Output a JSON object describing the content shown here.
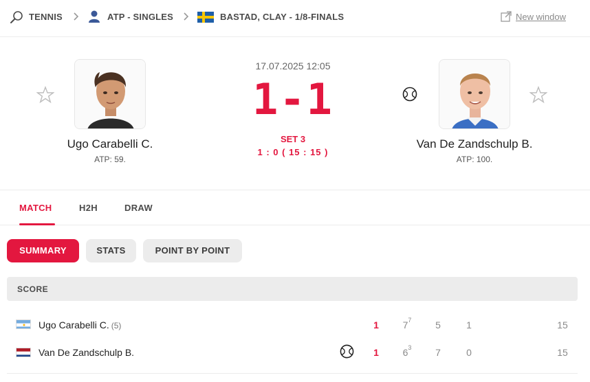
{
  "breadcrumb": {
    "sport": "TENNIS",
    "category": "ATP - SINGLES",
    "tournament": "BASTAD, CLAY - 1/8-FINALS",
    "new_window": "New window",
    "icons": [
      "racket-icon",
      "person-icon",
      "sweden-flag-icon",
      "external-link-icon"
    ]
  },
  "match": {
    "datetime": "17.07.2025 12:05",
    "score": "1-1",
    "set_label": "SET 3",
    "set_detail": "1 : 0 ( 15 : 15 )",
    "home": {
      "name": "Ugo Carabelli C.",
      "rank": "ATP: 59."
    },
    "away": {
      "name": "Van De Zandschulp B.",
      "rank": "ATP: 100.",
      "serving": true
    }
  },
  "tabs": [
    "MATCH",
    "H2H",
    "DRAW"
  ],
  "active_tab": "MATCH",
  "subtabs": [
    "SUMMARY",
    "STATS",
    "POINT BY POINT"
  ],
  "active_subtab": "SUMMARY",
  "score_table": {
    "header": "SCORE",
    "rows": [
      {
        "name": "Ugo Carabelli C.",
        "seed": "(5)",
        "flag": "argentina",
        "sets_won": "1",
        "s1": "7",
        "s1_tb": "7",
        "s2": "5",
        "s3": "1",
        "points": "15"
      },
      {
        "name": "Van De Zandschulp B.",
        "seed": "",
        "flag": "netherlands",
        "serving": true,
        "sets_won": "1",
        "s1": "6",
        "s1_tb": "3",
        "s2": "7",
        "s3": "0",
        "points": "15"
      }
    ]
  },
  "colors": {
    "accent": "#e3173f",
    "muted": "#8a8a8a",
    "pill_bg": "#ececec"
  }
}
